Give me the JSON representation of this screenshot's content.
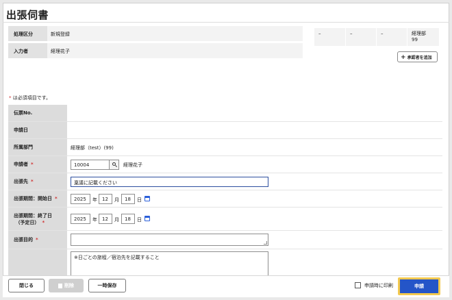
{
  "page": {
    "title": "出張伺書"
  },
  "info": {
    "process_label": "処理区分",
    "process_value": "新規登録",
    "creator_label": "入力者",
    "creator_value": "経理花子"
  },
  "approval": {
    "cells": [
      "–",
      "–",
      "–"
    ],
    "dept": "経理部",
    "dept_code": "99",
    "add_button_label": "承認者を追加",
    "add_icon": "plus-icon"
  },
  "required_note": {
    "mark": "*",
    "text": "は必須項目です。"
  },
  "form": {
    "slip_no_label": "伝票No.",
    "apply_date_label": "申請日",
    "dept_label": "所属部門",
    "dept_value": "経理部（test）(99)",
    "applicant_label": "申請者",
    "applicant_id": "10004",
    "applicant_name": "経理花子",
    "destination_label": "出張先",
    "destination_value": "稟議に記載ください",
    "start_label": "出張期間：開始日",
    "start_year": "2025",
    "start_month": "12",
    "start_day": "18",
    "end_label_line1": "出張期間：終了日",
    "end_label_line2": "（予定日）",
    "end_year": "2025",
    "end_month": "12",
    "end_day": "18",
    "unit_year": "年",
    "unit_month": "月",
    "unit_day": "日",
    "purpose_label": "出張目的",
    "purpose_value": "",
    "itinerary_value": "※日ごとの旅程／宿泊先を記載すること",
    "required_mark": "*"
  },
  "footer": {
    "close_label": "閉じる",
    "delete_label": "削除",
    "save_label": "一時保存",
    "print_label": "申請時に印刷",
    "apply_label": "申請"
  },
  "colors": {
    "accent": "#2455c8",
    "required": "#d03030",
    "focus": "#f3c94f"
  }
}
